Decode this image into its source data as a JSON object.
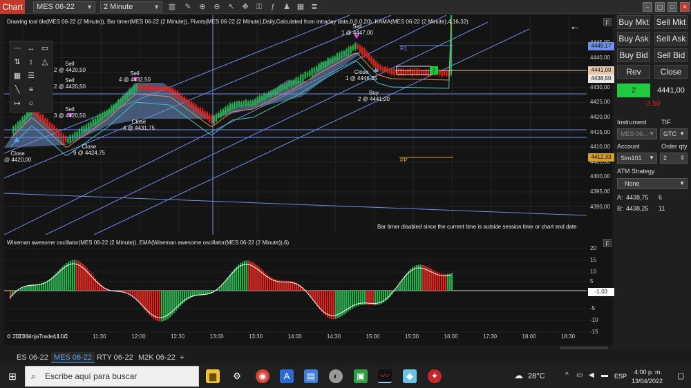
{
  "titlebar": {
    "app_label": "Chart",
    "instrument": "MES 06-22",
    "interval": "2 Minute"
  },
  "chart": {
    "price_title": "Drawing tool tile(MES 06-22 (2 Minute)), Bar timer(MES 06-22 (2 Minute)), Pivots(MES 06-22 (2 Minute),Daily,Calculated from intraday data,0,0,0,20), KAMA(MES 06-22 (2 Minute),4,16,32)",
    "osc_title": "Wiseman awesome oscillator(MES 06-22 (2 Minute)), EMA(Wiseman awesome oscillator(MES 06-22 (2 Minute)),6)",
    "bar_timer_msg": "Bar timer disabled since the current time is outside session time or chart end date",
    "copyright": "© 2022 NinjaTrader, LLC",
    "f_label": "F",
    "r1": "R1",
    "pp": "PP",
    "position_pnl": "-2,50",
    "position_qty": "2",
    "price_axis": [
      "4445,00",
      "4440,00",
      "4435,00",
      "4430,00",
      "4425,00",
      "4420,00",
      "4415,00",
      "4410,00",
      "4405,00",
      "4400,00",
      "4395,00",
      "4390,00"
    ],
    "price_tags": {
      "r1": "4449,17",
      "avg": "4441,00",
      "last": "4438,50",
      "pp": "4412,33"
    },
    "osc_axis": [
      "20",
      "15",
      "10",
      "5",
      "-5",
      "-10",
      "-15"
    ],
    "osc_tag": "-1,03",
    "time_axis": [
      "10:30",
      "11:00",
      "11:30",
      "12:00",
      "12:30",
      "13:00",
      "13:30",
      "14:00",
      "14:30",
      "15:00",
      "15:30",
      "16:00",
      "17:30",
      "18:00",
      "18:30"
    ],
    "time_axis_extra": "17:30",
    "annotations": [
      {
        "text": "Sell\n2 @ 4420,50"
      },
      {
        "text": "Sell\n2 @ 4420,50"
      },
      {
        "text": "Sell\n3 @ 4420,50"
      },
      {
        "text": "Close\n@ 4420,00"
      },
      {
        "text": "Close\n9 @ 4424,75"
      },
      {
        "text": "Sell\n4 @ 4432,50"
      },
      {
        "text": "Close\n4 @ 4431,75"
      },
      {
        "text": "Sell\n1 @ 4447,00"
      },
      {
        "text": "Close\n1 @ 4446,25"
      },
      {
        "text": "Buy\n2 @ 4441,00"
      }
    ]
  },
  "tabs": [
    "ES 06-22",
    "MES 06-22",
    "RTY 06-22",
    "M2K 06-22",
    "+"
  ],
  "active_tab": 1,
  "right_panel": {
    "buy_mkt": "Buy Mkt",
    "sell_mkt": "Sell Mkt",
    "buy_ask": "Buy Ask",
    "sell_ask": "Sell Ask",
    "buy_bid": "Buy Bid",
    "sell_bid": "Sell Bid",
    "rev": "Rev",
    "close": "Close",
    "position_qty": "2",
    "position_price": "4441,00",
    "pnl": "-2,50",
    "instrument_label": "Instrument",
    "tif_label": "TIF",
    "instrument_value": "MES 06...",
    "tif_value": "GTC",
    "account_label": "Account",
    "order_qty_label": "Order qty",
    "account_value": "Sim101",
    "order_qty_value": "2",
    "atm_label": "ATM Strategy",
    "atm_value": "None",
    "ask_label": "A:",
    "ask_price": "4438,75",
    "ask_size": "6",
    "bid_label": "B:",
    "bid_price": "4438,25",
    "bid_size": "11"
  },
  "taskbar": {
    "search_placeholder": "Escribe aquí para buscar",
    "weather": "28°C",
    "language": "ESP",
    "time": "4:00 p. m.",
    "date": "13/04/2022"
  },
  "colors": {
    "bull": "#22b14c",
    "bear": "#e0241b",
    "channel": "#6f8fe8",
    "zigzag_fill": "#6f8fc8",
    "kama": "#e89040",
    "ema": "#ffffff",
    "pp": "#d4a030",
    "green_tag": "#1fcc40",
    "accent_red": "#c0392b"
  }
}
